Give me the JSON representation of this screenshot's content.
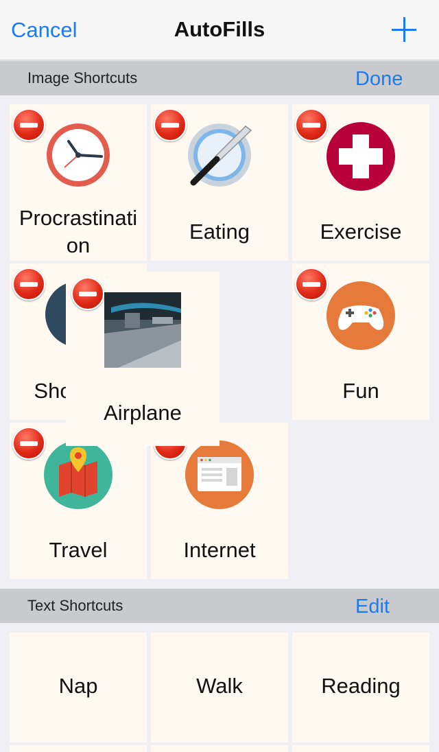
{
  "navbar": {
    "cancel_label": "Cancel",
    "title": "AutoFills"
  },
  "image_section": {
    "title": "Image Shortcuts",
    "action_label": "Done",
    "tiles": [
      {
        "label_line1": "Procrastinati",
        "label_line2": "on",
        "icon": "clock-icon"
      },
      {
        "label": "Eating",
        "icon": "plate-knife-icon"
      },
      {
        "label": "Exercise",
        "icon": "medical-cross-icon"
      },
      {
        "label": "Sho",
        "icon": "shopping-icon"
      },
      {
        "label": "Airplane",
        "icon": "airplane-photo"
      },
      {
        "label": "Fun",
        "icon": "gamepad-icon"
      },
      {
        "label": "Travel",
        "icon": "map-pin-icon"
      },
      {
        "label": "Internet",
        "icon": "browser-window-icon"
      }
    ]
  },
  "text_section": {
    "title": "Text Shortcuts",
    "action_label": "Edit",
    "tiles": [
      "Nap",
      "Walk",
      "Reading"
    ]
  },
  "colors": {
    "accent": "#1d7bf0",
    "tile_bg": "#fff9f1",
    "delete_red": "#e02a18"
  }
}
